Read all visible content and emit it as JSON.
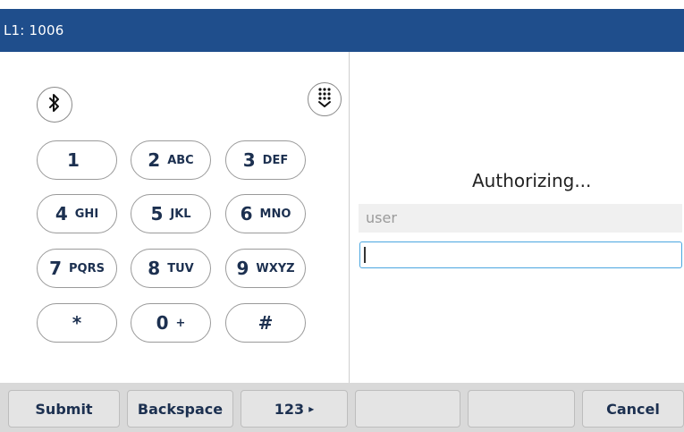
{
  "header": {
    "title": "L1: 1006"
  },
  "icons": {
    "bluetooth": "bluetooth-icon",
    "dialpad": "dialpad-collapse-icon"
  },
  "keypad": [
    {
      "num": "1",
      "letters": ""
    },
    {
      "num": "2",
      "letters": "ABC"
    },
    {
      "num": "3",
      "letters": "DEF"
    },
    {
      "num": "4",
      "letters": "GHI"
    },
    {
      "num": "5",
      "letters": "JKL"
    },
    {
      "num": "6",
      "letters": "MNO"
    },
    {
      "num": "7",
      "letters": "PQRS"
    },
    {
      "num": "8",
      "letters": "TUV"
    },
    {
      "num": "9",
      "letters": "WXYZ"
    },
    {
      "num": "*",
      "letters": ""
    },
    {
      "num": "0",
      "letters": "+"
    },
    {
      "num": "#",
      "letters": ""
    }
  ],
  "auth": {
    "status": "Authorizing...",
    "user_value": "user",
    "password_value": ""
  },
  "softkeys": [
    {
      "label": "Submit"
    },
    {
      "label": "Backspace"
    },
    {
      "label": "123",
      "arrow": "▸"
    },
    {
      "label": ""
    },
    {
      "label": ""
    },
    {
      "label": "Cancel"
    }
  ],
  "colors": {
    "header_bg": "#1f4e8c",
    "text_dark": "#1c3050",
    "focus_border": "#4aa6e0"
  }
}
